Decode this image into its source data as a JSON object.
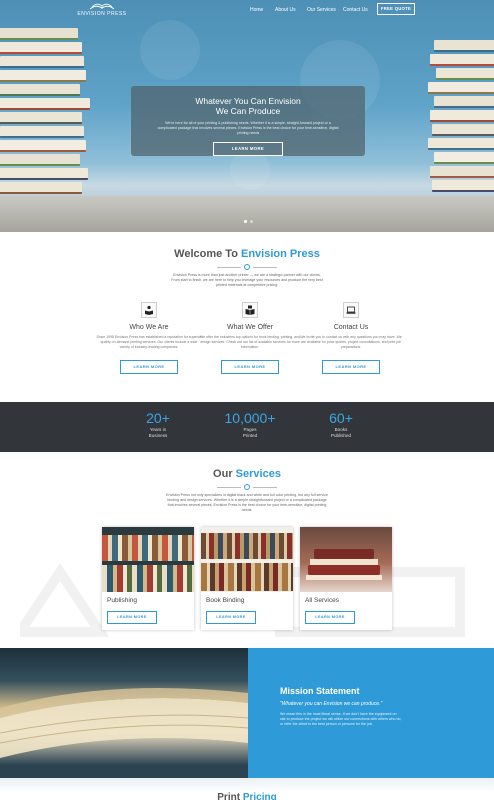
{
  "brand": {
    "name": "ENVISION PRESS"
  },
  "nav": {
    "items": [
      "Home",
      "About Us",
      "Our Services",
      "Contact Us"
    ],
    "cta": "FREE QUOTE"
  },
  "hero": {
    "title_line1": "Whatever You Can Envision",
    "title_line2": "We Can Produce",
    "text": "We're here for all of your printing & publishing needs. Whether it is a simple, straight-forward project or a complicated package that involves several pieces, Envision Press is the best choice for your time-sensitive, digital printing needs",
    "button": "LEARN MORE"
  },
  "welcome": {
    "title_plain": "Welcome To",
    "title_accent": "Envision Press",
    "intro": "Envision Press is more than just another printer — we are a strategic partner with our clients. From start to finish, we are here to help you leverage your resources and produce the very best printed materials at competitive pricing.",
    "features": [
      {
        "icon": "reader-icon",
        "title": "Who We Are",
        "text": "Since 1998 Envision Press has established a reputation for superior quality on-demand printing services. Our clients include a wide variety of industry-leading companies.",
        "button": "LEARN MORE"
      },
      {
        "icon": "open-book-icon",
        "title": "What We Offer",
        "text": "We offer the industries top options for book binding, printing, and design services. Check out our list of available services for more information.",
        "button": "LEARN MORE"
      },
      {
        "icon": "laptop-icon",
        "title": "Contact Us",
        "text": "We invite you to contact us with any questions you may have. We are available for price quotes, project consultations, and print job preparations.",
        "button": "LEARN MORE"
      }
    ]
  },
  "stats": [
    {
      "number": "20+",
      "label1": "Years in",
      "label2": "Business"
    },
    {
      "number": "10,000+",
      "label1": "Pages",
      "label2": "Printed"
    },
    {
      "number": "60+",
      "label1": "Books",
      "label2": "Published"
    }
  ],
  "services": {
    "title_plain": "Our",
    "title_accent": "Services",
    "intro": "Envision Press not only specializes in digital black and white and full color printing, but any full service binding and design services. Whether it is a simple straightforward project or a complicated package that involves several pieces, Envision Press is the best choice for your time-sensitive, digital printing needs.",
    "cards": [
      {
        "title": "Publishing",
        "button": "LEARN MORE"
      },
      {
        "title": "Book Binding",
        "button": "LEARN MORE"
      },
      {
        "title": "All Services",
        "button": "LEARN MORE"
      }
    ]
  },
  "mission": {
    "title": "Mission Statement",
    "quote": "\"Whatever you can Envision we can produce.\"",
    "text": "We mean this in the most literal sense. If we don't have the equipment on site to produce the project we will utilize our connections with others who do, or refer the client to the best person or persons for the job."
  },
  "pricing": {
    "title_plain": "Print",
    "title_accent": "Pricing"
  },
  "colors": {
    "accent": "#2e9ad8",
    "stats_bg": "#323539",
    "stat_number": "#3aa6e6"
  }
}
